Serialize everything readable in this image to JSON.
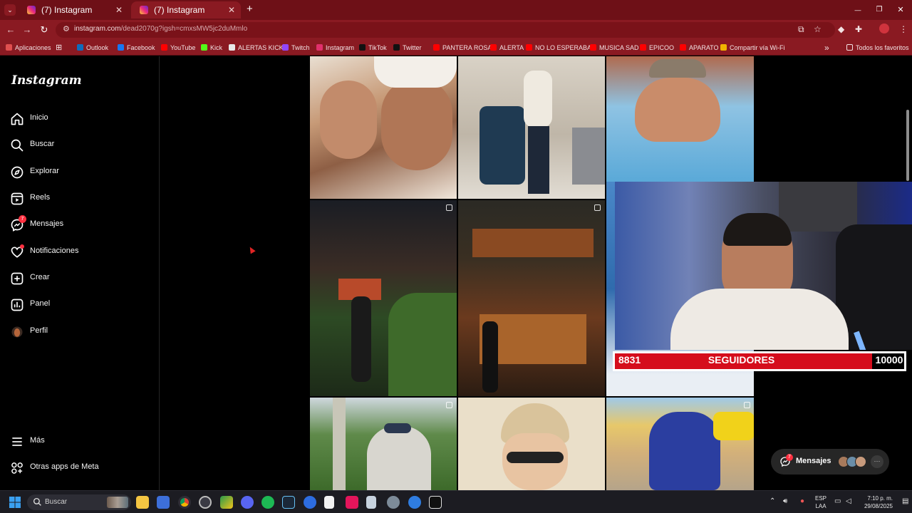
{
  "browser": {
    "tabs": [
      {
        "title": "(7) Instagram"
      },
      {
        "title": "(7) Instagram"
      }
    ],
    "new_tab": "+",
    "url_host": "instagram.com",
    "url_path": "/dead2070g?igsh=cmxsMW5jc2duMmlo",
    "window_controls": {
      "minimize": "—",
      "restore": "❐",
      "close": "✕"
    }
  },
  "bookmarks": {
    "apps_label": "Aplicaciones",
    "items": [
      {
        "label": "Outlook",
        "color": "#0f6cbd"
      },
      {
        "label": "Facebook",
        "color": "#1877f2"
      },
      {
        "label": "YouTube",
        "color": "#ff0000"
      },
      {
        "label": "Kick",
        "color": "#53fc18"
      },
      {
        "label": "ALERTAS KICK",
        "color": "#e8e8e8"
      },
      {
        "label": "Twitch",
        "color": "#9146ff"
      },
      {
        "label": "Instagram",
        "color": "#e1306c"
      },
      {
        "label": "TikTok",
        "color": "#111111"
      },
      {
        "label": "Twitter",
        "color": "#111111"
      },
      {
        "label": "PANTERA ROSA",
        "color": "#ff0000"
      },
      {
        "label": "ALERTA",
        "color": "#ff0000"
      },
      {
        "label": "NO LO ESPERABA",
        "color": "#ff0000"
      },
      {
        "label": "MUSICA SAD",
        "color": "#ff0000"
      },
      {
        "label": "EPICOO",
        "color": "#ff0000"
      },
      {
        "label": "APARATO",
        "color": "#ff0000"
      },
      {
        "label": "Compartir vía Wi-Fi",
        "color": "#f0b400"
      }
    ],
    "overflow": "»",
    "all_bookmarks": "Todos los favoritos"
  },
  "sidebar": {
    "logo": "Instagram",
    "nav": [
      {
        "label": "Inicio",
        "icon": "home-icon"
      },
      {
        "label": "Buscar",
        "icon": "search-icon"
      },
      {
        "label": "Explorar",
        "icon": "compass-icon"
      },
      {
        "label": "Reels",
        "icon": "reels-icon"
      },
      {
        "label": "Mensajes",
        "icon": "messenger-icon",
        "badge": "7"
      },
      {
        "label": "Notificaciones",
        "icon": "heart-icon"
      },
      {
        "label": "Crear",
        "icon": "plus-square-icon"
      },
      {
        "label": "Panel",
        "icon": "chart-icon"
      },
      {
        "label": "Perfil",
        "icon": "avatar-icon"
      }
    ],
    "more": "Más",
    "meta_apps": "Otras apps de Meta"
  },
  "overlay": {
    "followers_current": "8831",
    "followers_label": "SEGUIDORES",
    "followers_goal": "10000"
  },
  "messages_pill": {
    "label": "Mensajes",
    "badge": "7",
    "more": "···"
  },
  "taskbar": {
    "search_placeholder": "Buscar",
    "lang_top": "ESP",
    "lang_bottom": "LAA",
    "time": "7:10 p. m.",
    "date": "29/08/2025"
  },
  "colors": {
    "chrome_frame": "#6e1017",
    "chrome_toolbar": "#8a1a22",
    "notification_red": "#ff3040",
    "overlay_red": "#d50d1c"
  }
}
